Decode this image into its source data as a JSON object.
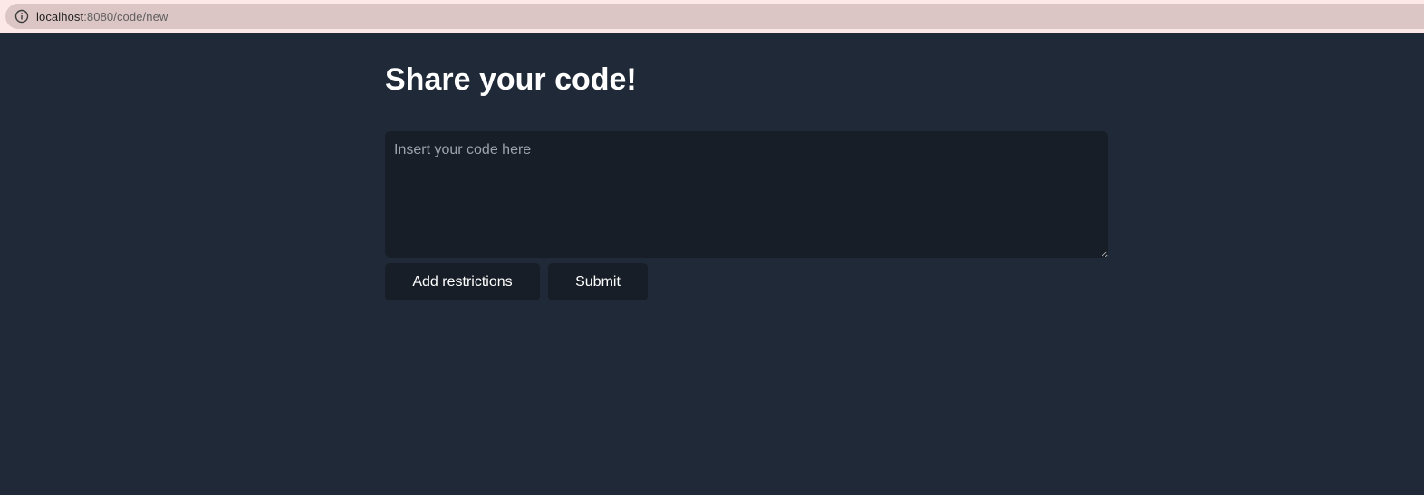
{
  "browser": {
    "url_host": "localhost",
    "url_path": ":8080/code/new",
    "info_icon": "info-circle-icon"
  },
  "main": {
    "title": "Share your code!",
    "code_input": {
      "placeholder": "Insert your code here",
      "value": ""
    },
    "buttons": {
      "add_restrictions_label": "Add restrictions",
      "submit_label": "Submit"
    }
  },
  "colors": {
    "page_background": "#1f2937",
    "input_background": "#171e27",
    "browser_bar": "#fce8e6",
    "url_pill": "#dcc5c5",
    "title_text": "#ffffff"
  }
}
